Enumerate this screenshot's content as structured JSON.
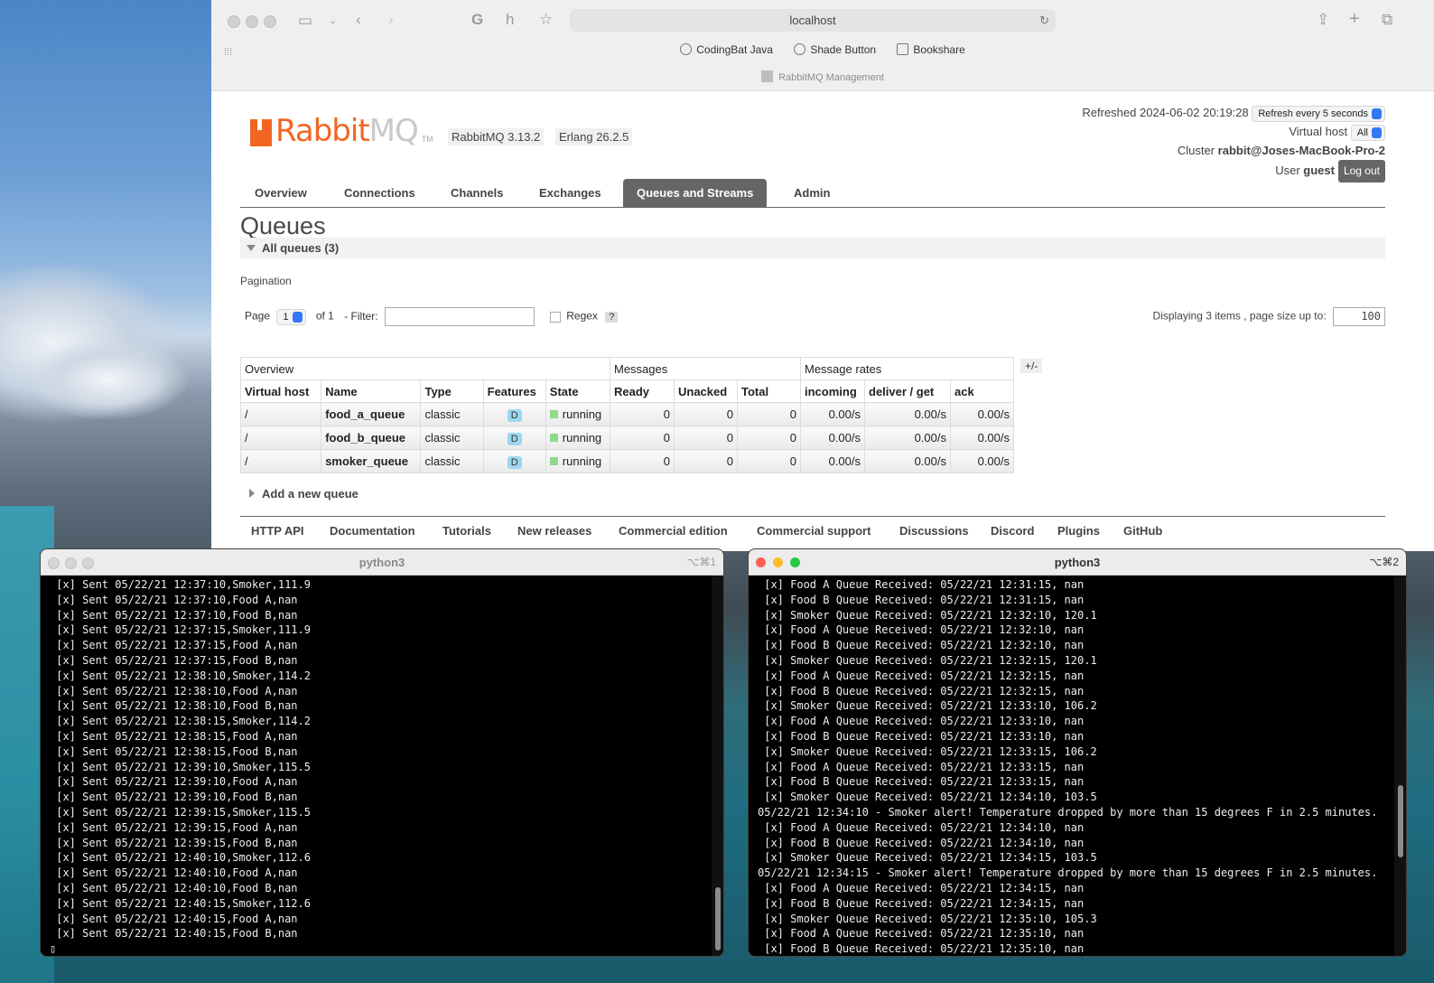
{
  "browser": {
    "url": "localhost",
    "bookmarks": [
      "CodingBat Java",
      "Shade Button",
      "Bookshare"
    ],
    "tab_title": "RabbitMQ Management"
  },
  "rabbit": {
    "logo_brand": "Rabbit",
    "logo_mq": "MQ",
    "logo_tm": "TM",
    "version": "RabbitMQ 3.13.2",
    "erlang": "Erlang 26.2.5",
    "refreshed_label": "Refreshed 2024-06-02 20:19:28",
    "refresh_select": "Refresh every 5 seconds",
    "vhost_label": "Virtual host",
    "vhost_select": "All",
    "cluster_label": "Cluster",
    "cluster_name": "rabbit@Joses-MacBook-Pro-2",
    "user_label": "User",
    "user_name": "guest",
    "logout": "Log out",
    "tabs": [
      "Overview",
      "Connections",
      "Channels",
      "Exchanges",
      "Queues and Streams",
      "Admin"
    ],
    "active_tab": "Queues and Streams",
    "heading": "Queues",
    "all_queues": "All queues (3)",
    "pagination": "Pagination",
    "page_label": "Page",
    "page_value": "1",
    "of_label": "of 1",
    "filter_label": "- Filter:",
    "regex_label": "Regex",
    "help": "?",
    "displaying": "Displaying 3 items , page size up to:",
    "page_size": "100",
    "group_headers": [
      "Overview",
      "Messages",
      "Message rates"
    ],
    "plus_minus": "+/-",
    "columns": [
      "Virtual host",
      "Name",
      "Type",
      "Features",
      "State",
      "Ready",
      "Unacked",
      "Total",
      "incoming",
      "deliver / get",
      "ack"
    ],
    "rows": [
      {
        "vhost": "/",
        "name": "food_a_queue",
        "type": "classic",
        "feature": "D",
        "state": "running",
        "ready": "0",
        "unacked": "0",
        "total": "0",
        "incoming": "0.00/s",
        "deliver": "0.00/s",
        "ack": "0.00/s"
      },
      {
        "vhost": "/",
        "name": "food_b_queue",
        "type": "classic",
        "feature": "D",
        "state": "running",
        "ready": "0",
        "unacked": "0",
        "total": "0",
        "incoming": "0.00/s",
        "deliver": "0.00/s",
        "ack": "0.00/s"
      },
      {
        "vhost": "/",
        "name": "smoker_queue",
        "type": "classic",
        "feature": "D",
        "state": "running",
        "ready": "0",
        "unacked": "0",
        "total": "0",
        "incoming": "0.00/s",
        "deliver": "0.00/s",
        "ack": "0.00/s"
      }
    ],
    "add_queue": "Add a new queue",
    "footer_links": [
      "HTTP API",
      "Documentation",
      "Tutorials",
      "New releases",
      "Commercial edition",
      "Commercial support",
      "Discussions",
      "Discord",
      "Plugins",
      "GitHub"
    ]
  },
  "terminal1": {
    "title": "python3",
    "shortcut": "⌥⌘1",
    "lines": [
      " [x] Sent 05/22/21 12:37:10,Smoker,111.9",
      " [x] Sent 05/22/21 12:37:10,Food A,nan",
      " [x] Sent 05/22/21 12:37:10,Food B,nan",
      " [x] Sent 05/22/21 12:37:15,Smoker,111.9",
      " [x] Sent 05/22/21 12:37:15,Food A,nan",
      " [x] Sent 05/22/21 12:37:15,Food B,nan",
      " [x] Sent 05/22/21 12:38:10,Smoker,114.2",
      " [x] Sent 05/22/21 12:38:10,Food A,nan",
      " [x] Sent 05/22/21 12:38:10,Food B,nan",
      " [x] Sent 05/22/21 12:38:15,Smoker,114.2",
      " [x] Sent 05/22/21 12:38:15,Food A,nan",
      " [x] Sent 05/22/21 12:38:15,Food B,nan",
      " [x] Sent 05/22/21 12:39:10,Smoker,115.5",
      " [x] Sent 05/22/21 12:39:10,Food A,nan",
      " [x] Sent 05/22/21 12:39:10,Food B,nan",
      " [x] Sent 05/22/21 12:39:15,Smoker,115.5",
      " [x] Sent 05/22/21 12:39:15,Food A,nan",
      " [x] Sent 05/22/21 12:39:15,Food B,nan",
      " [x] Sent 05/22/21 12:40:10,Smoker,112.6",
      " [x] Sent 05/22/21 12:40:10,Food A,nan",
      " [x] Sent 05/22/21 12:40:10,Food B,nan",
      " [x] Sent 05/22/21 12:40:15,Smoker,112.6",
      " [x] Sent 05/22/21 12:40:15,Food A,nan",
      " [x] Sent 05/22/21 12:40:15,Food B,nan",
      "▯"
    ]
  },
  "terminal2": {
    "title": "python3",
    "shortcut": "⌥⌘2",
    "lines": [
      " [x] Food A Queue Received: 05/22/21 12:31:15, nan",
      " [x] Food B Queue Received: 05/22/21 12:31:15, nan",
      " [x] Smoker Queue Received: 05/22/21 12:32:10, 120.1",
      " [x] Food A Queue Received: 05/22/21 12:32:10, nan",
      " [x] Food B Queue Received: 05/22/21 12:32:10, nan",
      " [x] Smoker Queue Received: 05/22/21 12:32:15, 120.1",
      " [x] Food A Queue Received: 05/22/21 12:32:15, nan",
      " [x] Food B Queue Received: 05/22/21 12:32:15, nan",
      " [x] Smoker Queue Received: 05/22/21 12:33:10, 106.2",
      " [x] Food A Queue Received: 05/22/21 12:33:10, nan",
      " [x] Food B Queue Received: 05/22/21 12:33:10, nan",
      " [x] Smoker Queue Received: 05/22/21 12:33:15, 106.2",
      " [x] Food A Queue Received: 05/22/21 12:33:15, nan",
      " [x] Food B Queue Received: 05/22/21 12:33:15, nan",
      " [x] Smoker Queue Received: 05/22/21 12:34:10, 103.5",
      "05/22/21 12:34:10 - Smoker alert! Temperature dropped by more than 15 degrees F in 2.5 minutes.",
      " [x] Food A Queue Received: 05/22/21 12:34:10, nan",
      " [x] Food B Queue Received: 05/22/21 12:34:10, nan",
      " [x] Smoker Queue Received: 05/22/21 12:34:15, 103.5",
      "05/22/21 12:34:15 - Smoker alert! Temperature dropped by more than 15 degrees F in 2.5 minutes.",
      " [x] Food A Queue Received: 05/22/21 12:34:15, nan",
      " [x] Food B Queue Received: 05/22/21 12:34:15, nan",
      " [x] Smoker Queue Received: 05/22/21 12:35:10, 105.3",
      " [x] Food A Queue Received: 05/22/21 12:35:10, nan",
      " [x] Food B Queue Received: 05/22/21 12:35:10, nan"
    ]
  },
  "colors": {
    "rabbit_orange": "#f26522",
    "tab_active": "#666666",
    "running": "#8fd98f",
    "durable_badge": "#9cd7f0"
  }
}
